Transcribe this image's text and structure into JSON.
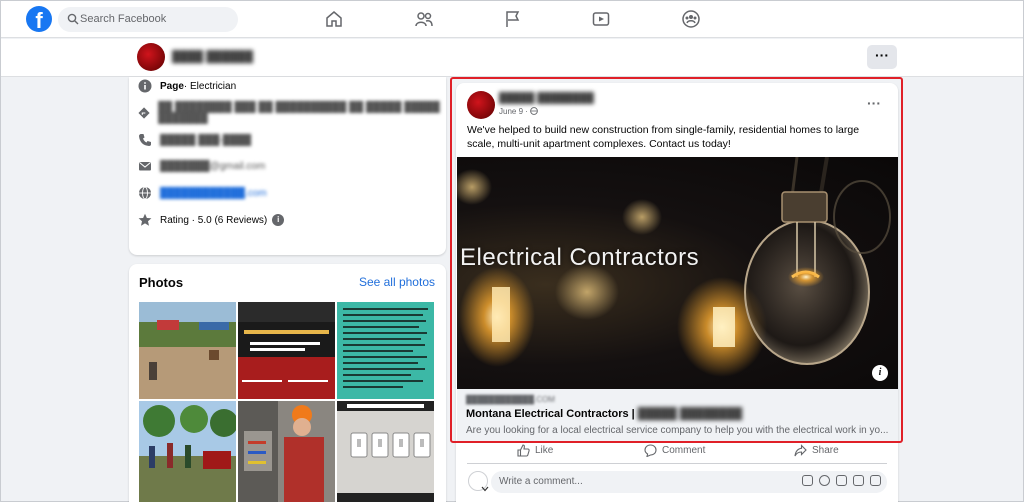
{
  "search": {
    "placeholder": "Search Facebook"
  },
  "nav": {
    "icons": [
      "home-icon",
      "friends-icon",
      "pages-flag-icon",
      "watch-video-icon",
      "groups-icon"
    ]
  },
  "intro": {
    "category_label": "Page",
    "category_value": " · Electrician",
    "rating": "Rating · 5.0 (6 Reviews)"
  },
  "photos": {
    "title": "Photos",
    "see_all": "See all photos"
  },
  "post": {
    "date": "June 9 · ",
    "text": "We've helped to build new construction from single-family, residential homes to large scale, multi-unit apartment complexes. Contact us today!",
    "image_text": "Electrical Contractors",
    "link_title": "Montana Electrical Contractors | ",
    "link_desc": "Are you looking for a local electrical service company to help you with the electrical work in yo..."
  },
  "actions": {
    "like": "Like",
    "comment": "Comment",
    "share": "Share"
  },
  "comment": {
    "placeholder": "Write a comment..."
  },
  "colors": {
    "brand": "#1877f2",
    "highlight": "#e02028",
    "link": "#216fdb"
  }
}
